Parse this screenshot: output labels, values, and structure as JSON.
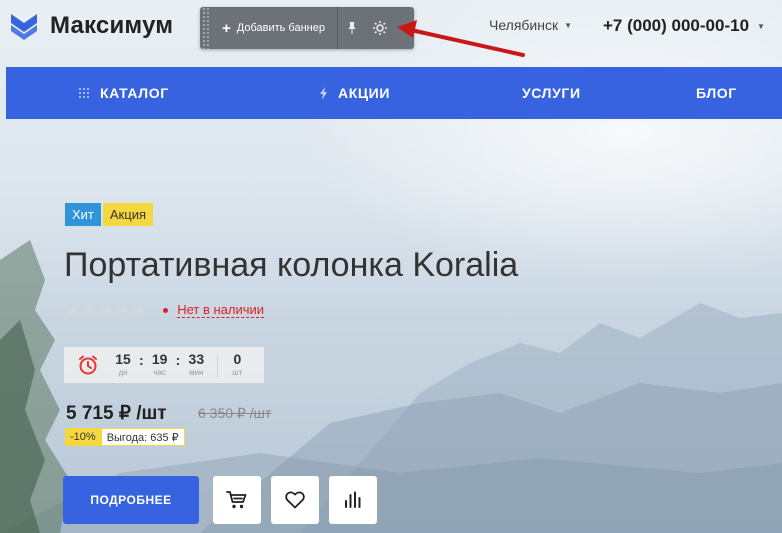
{
  "header": {
    "brand": "Максимум",
    "city": "Челябинск",
    "phone": "+7 (000) 000-00-10"
  },
  "admin_bar": {
    "add_banner_label": "Добавить баннер"
  },
  "nav": {
    "items": [
      {
        "label": "КАТАЛОГ",
        "icon": "grid-icon"
      },
      {
        "label": "АКЦИИ",
        "icon": "lightning-icon"
      },
      {
        "label": "УСЛУГИ",
        "icon": ""
      },
      {
        "label": "БЛОГ",
        "icon": ""
      }
    ]
  },
  "product": {
    "badges": [
      "Хит",
      "Акция"
    ],
    "title": "Портативная колонка Koralia",
    "rating": 0,
    "rating_max": 5,
    "stock_status": "Нет в наличии",
    "timer": {
      "days": "15",
      "days_label": "дн",
      "hours": "19",
      "hours_label": "час",
      "minutes": "33",
      "minutes_label": "мин",
      "quantity": "0",
      "quantity_label": "шт"
    },
    "price": "5 715 ₽ /шт",
    "old_price": "6 350 ₽ /шт",
    "discount_percent": "-10%",
    "savings": "Выгода: 635 ₽",
    "more_button": "ПОДРОБНЕЕ"
  },
  "colors": {
    "accent": "#3763e0",
    "badge_hit": "#2f95d8",
    "badge_sale": "#f5d83e",
    "out_of_stock": "#dd2222",
    "arrow": "#c81818"
  }
}
